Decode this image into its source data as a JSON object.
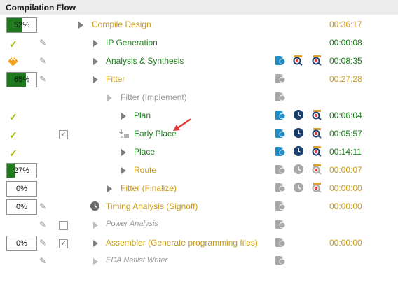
{
  "header": {
    "title": "Compilation Flow"
  },
  "rows": [
    {
      "status": "52%",
      "task": "Compile Design",
      "time": "00:36:17"
    },
    {
      "task": "IP Generation",
      "time": "00:00:08"
    },
    {
      "task": "Analysis & Synthesis",
      "time": "00:08:35"
    },
    {
      "status": "65%",
      "task": "Fitter",
      "time": "00:27:28"
    },
    {
      "task": "Fitter (Implement)",
      "time": ""
    },
    {
      "task": "Plan",
      "time": "00:06:04"
    },
    {
      "task": "Early Place",
      "time": "00:05:57"
    },
    {
      "task": "Place",
      "time": "00:14:11"
    },
    {
      "status": "27%",
      "task": "Route",
      "time": "00:00:07"
    },
    {
      "status": "0%",
      "task": "Fitter (Finalize)",
      "time": "00:00:00"
    },
    {
      "status": "0%",
      "task": "Timing Analysis (Signoff)",
      "time": "00:00:00"
    },
    {
      "task": "Power Analysis",
      "time": ""
    },
    {
      "status": "0%",
      "task": "Assembler (Generate programming files)",
      "time": "00:00:00"
    },
    {
      "task": "EDA Netlist Writer",
      "time": ""
    }
  ],
  "progress": {
    "r0": 0.52,
    "r3": 0.65,
    "r8": 0.27,
    "r9": 0.0,
    "r10": 0.0,
    "r12": 0.0
  },
  "colors": {
    "gold": "#c89a1a",
    "green": "#1b7d1b",
    "progress": "#1f7a1f",
    "tool_blue": "#1d8dc8",
    "clock": "#1a3f6e",
    "arrow": "#e53935"
  }
}
